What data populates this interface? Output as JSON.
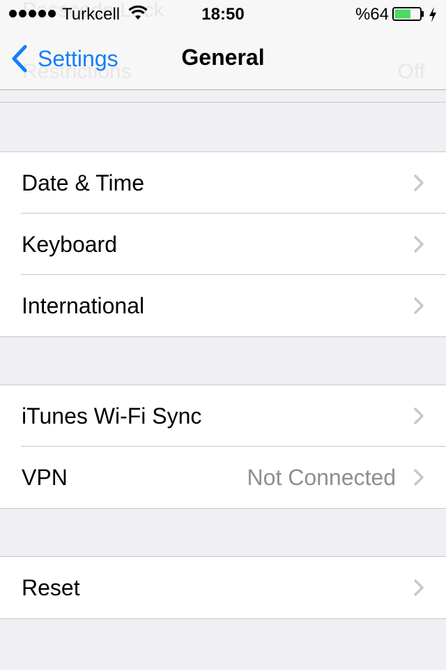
{
  "status_bar": {
    "carrier": "Turkcell",
    "time": "18:50",
    "battery_percent": "%64",
    "battery_level": 0.64,
    "signal_bars": 5
  },
  "background_ghost": {
    "top_item": "Passcode Lock",
    "restrictions_label": "Restrictions",
    "restrictions_value": "Off"
  },
  "nav": {
    "back_label": "Settings",
    "title": "General"
  },
  "colors": {
    "accent": "#147efb",
    "detail_text": "#8e8e93",
    "chevron": "#c7c7cc",
    "battery_fill": "#4cd964",
    "background": "#efeff4"
  },
  "groups": [
    {
      "rows": [
        {
          "label": "Date & Time",
          "detail": ""
        },
        {
          "label": "Keyboard",
          "detail": ""
        },
        {
          "label": "International",
          "detail": ""
        }
      ]
    },
    {
      "rows": [
        {
          "label": "iTunes Wi-Fi Sync",
          "detail": ""
        },
        {
          "label": "VPN",
          "detail": "Not Connected"
        }
      ]
    },
    {
      "rows": [
        {
          "label": "Reset",
          "detail": ""
        }
      ]
    }
  ]
}
